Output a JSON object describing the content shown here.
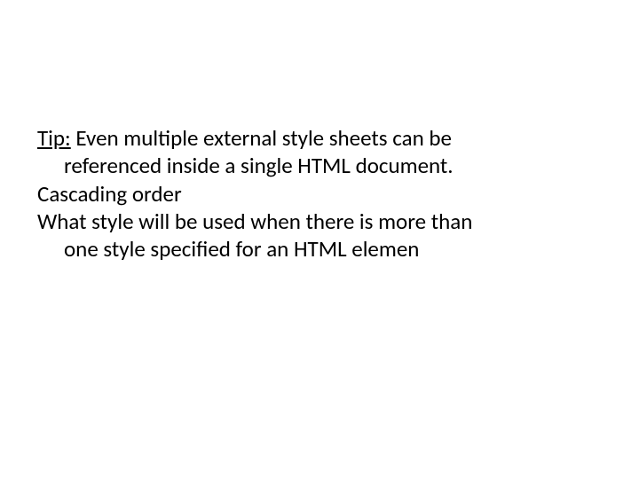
{
  "tip_label": "Tip:",
  "tip_line1_rest": " Even multiple external style sheets can be",
  "tip_line2": "referenced inside a single HTML document.",
  "heading": "Cascading order",
  "question_line1": "What style will be used when there is more than",
  "question_line2": "one style specified for an HTML elemen"
}
